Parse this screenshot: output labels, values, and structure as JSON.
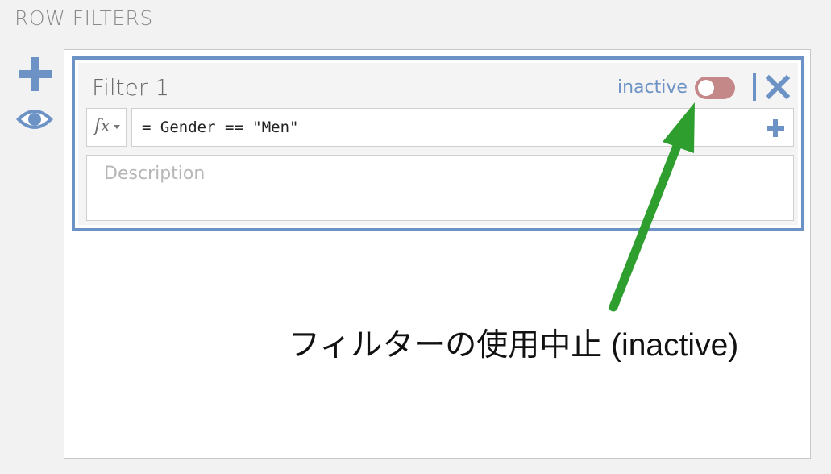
{
  "section": {
    "title": "ROW FILTERS"
  },
  "sidebar": {
    "add_icon": "plus-icon",
    "visibility_icon": "eye-icon"
  },
  "filter": {
    "title": "Filter 1",
    "status_label": "inactive",
    "active": false,
    "close_icon": "close-icon",
    "formula_button": {
      "label": "fx",
      "icon": "function-icon"
    },
    "formula": "= Gender == \"Men\"",
    "formula_add_icon": "plus-icon",
    "description_placeholder": "Description"
  },
  "annotation": {
    "text": "フィルターの使用中止 (inactive)"
  },
  "colors": {
    "accent_blue": "#6d93c6",
    "toggle_inactive": "#c48888",
    "arrow_green": "#2e9e2f"
  }
}
